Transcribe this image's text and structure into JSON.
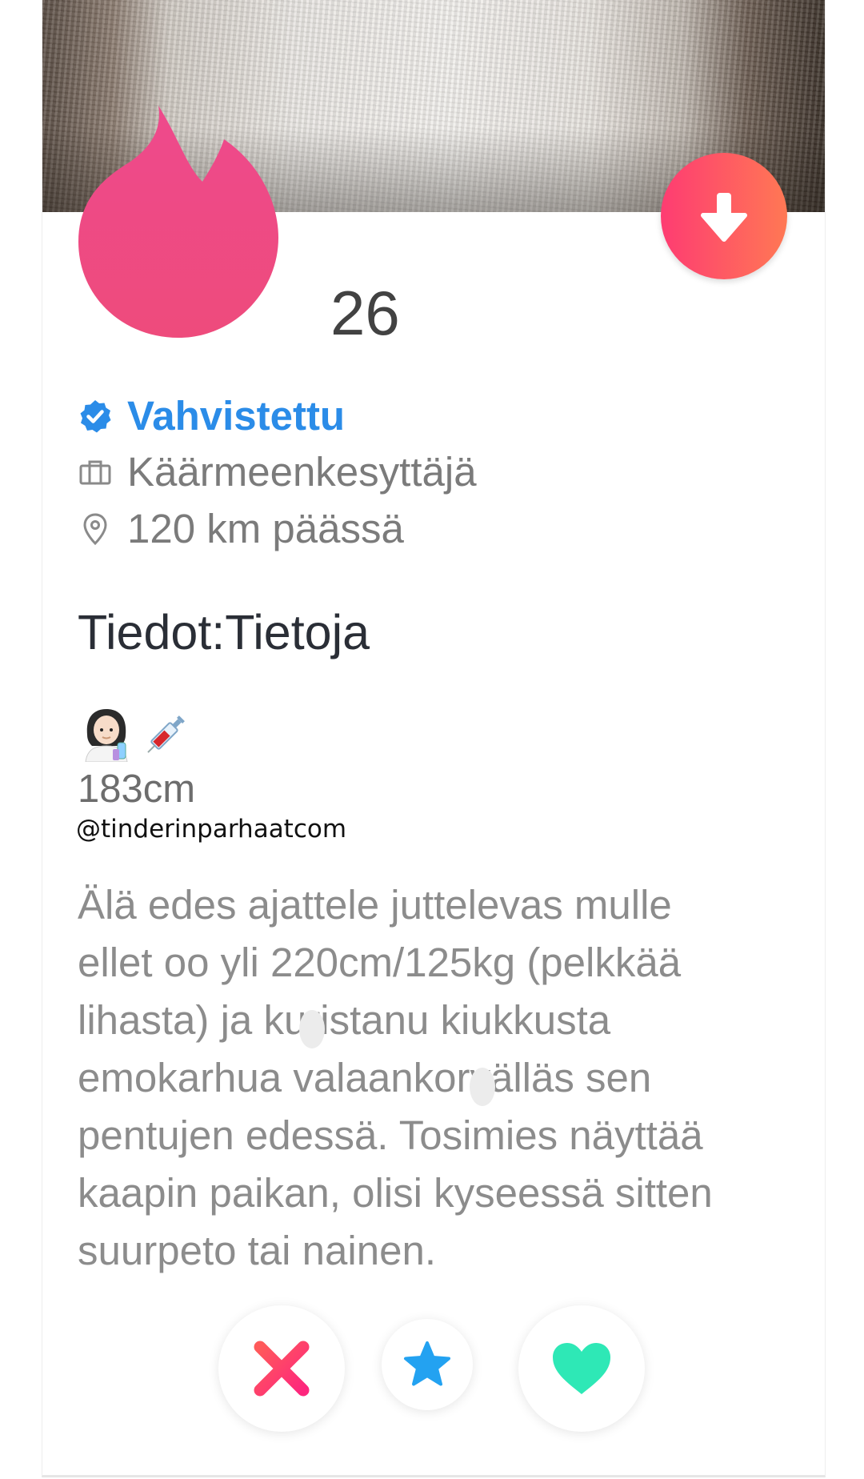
{
  "profile": {
    "age": "26",
    "verified_label": "Vahvistettu",
    "job": "Käärmeenkesyttäjä",
    "distance": "120 km päässä"
  },
  "about": {
    "heading": "Tiedot:Tietoja",
    "emojis": [
      "woman-health-worker-emoji",
      "syringe-emoji"
    ],
    "height": "183cm",
    "bio": "Älä edes ajattele juttelevas mulle\nellet oo yli 220cm/125kg (pelkkää\nlihasta) ja kuristanu kiukkusta\nemokarhua valaankorvälläs sen\npentujen edessä. Tosimies näyttää\nkaapin paikan, olisi kyseessä sitten\nsuurpeto tai nainen."
  },
  "watermark": "@tinderinparhaatcom",
  "icons": {
    "verified": "verified-badge-icon",
    "job": "briefcase-icon",
    "location": "location-pin-icon",
    "collapse": "arrow-down-icon",
    "nope": "x-icon",
    "super_like": "star-icon",
    "like": "heart-icon",
    "censor": "tinder-flame-icon"
  },
  "colors": {
    "brand_start": "#fe3c72",
    "brand_end": "#ff7854",
    "verified_blue": "#2b8ce8",
    "like_green": "#2ee8b6",
    "star_blue": "#23a2f1",
    "nope_red": "#ff4458"
  }
}
